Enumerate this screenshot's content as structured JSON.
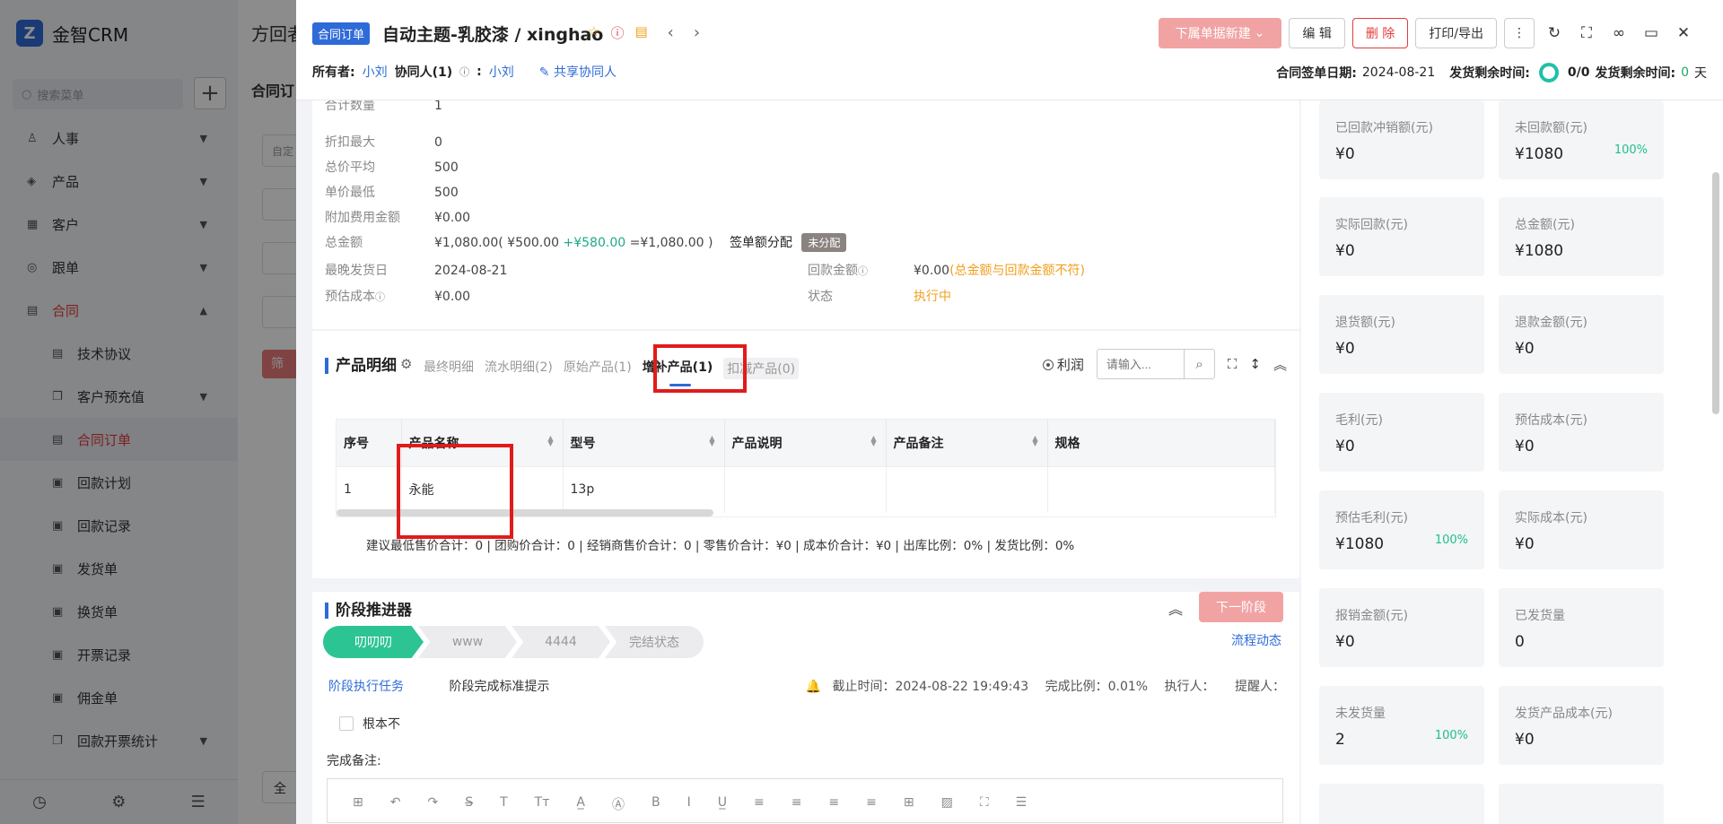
{
  "app": {
    "logo_text": "金智CRM",
    "logo_mark": "Z",
    "search_placeholder": "搜索菜单",
    "add_label": "+",
    "menu": [
      {
        "label": "人事",
        "icon": "person-icon"
      },
      {
        "label": "产品",
        "icon": "box-icon"
      },
      {
        "label": "客户",
        "icon": "building-icon"
      },
      {
        "label": "跟单",
        "icon": "target-icon"
      },
      {
        "label": "合同",
        "icon": "doc-icon"
      }
    ],
    "submenu": [
      "技术协议",
      "客户预充值",
      "合同订单",
      "回款计划",
      "回款记录",
      "发货单",
      "换货单",
      "开票记录",
      "佣金单",
      "回款开票统计"
    ]
  },
  "background": {
    "title": "方回者",
    "subtitle": "合同订",
    "box_text": "自定",
    "filter_label": "筛",
    "bottom_label": "全"
  },
  "header": {
    "tag": "合同订单",
    "title": "自动主题-乳胶漆 / xinghao",
    "new_doc_button": "下属单据新建",
    "edit_button": "编 辑",
    "delete_button": "删 除",
    "print_button": "打印/导出",
    "owner_label": "所有者:",
    "owner_value": "小刘",
    "collab_label": "协同人(1)",
    "collab_colon": ":",
    "collab_value": "小刘",
    "share_label": "共享协同人",
    "sign_date_label": "合同签单日期:",
    "sign_date_value": "2024-08-21",
    "ship_remain_label": "发货剩余时间:",
    "ship_ratio": "0/0",
    "ship_remain_label2": "发货剩余时间:",
    "ship_days": "0",
    "ship_days_unit": "天"
  },
  "info": {
    "rows": [
      {
        "k": "合计数量",
        "v": "1"
      },
      {
        "k": "折扣最大",
        "v": "0"
      },
      {
        "k": "总价平均",
        "v": "500"
      },
      {
        "k": "单价最低",
        "v": "500"
      },
      {
        "k": "附加费用金额",
        "v": "¥0.00"
      }
    ],
    "total_label": "总金额",
    "total_a": "¥1,080.00( ¥500.00 ",
    "total_b": "+¥580.00",
    "total_c": " =¥1,080.00 )",
    "sign_alloc": "签单额分配",
    "unallocated": "未分配",
    "latest_ship_label": "最晚发货日",
    "latest_ship_value": "2024-08-21",
    "payback_label": "回款金额",
    "payback_value": "¥0.00",
    "payback_warn": "(总金额与回款金额不符)",
    "est_cost_label": "预估成本",
    "est_cost_value": "¥0.00",
    "status_label": "状态",
    "status_value": "执行中"
  },
  "products": {
    "title": "产品明细",
    "tabs": [
      "最终明细",
      "流水明细(2)",
      "原始产品(1)",
      "增补产品(1)",
      "扣减产品(0)"
    ],
    "profit_label": "利润",
    "search_placeholder": "请输入...",
    "columns": [
      "序号",
      "产品名称",
      "型号",
      "产品说明",
      "产品备注",
      "规格"
    ],
    "rows": [
      {
        "no": "1",
        "name": "永能",
        "model": "13p",
        "desc": "",
        "remark": "",
        "spec": ""
      }
    ],
    "summary": "建议最低售价合计：0 |   团购价合计：0 |   经销商售价合计：0 |   零售价合计：¥0 |   成本价合计：¥0 |   出库比例：0% |   发货比例：0%"
  },
  "stage": {
    "title": "阶段推进器",
    "next_button": "下一阶段",
    "steps": [
      "叨叨叨",
      "www",
      "4444",
      "完结状态"
    ],
    "flow_link": "流程动态",
    "task_label": "阶段执行任务",
    "standard_label": "阶段完成标准提示",
    "deadline": "截止时间：2024-08-22 19:49:43",
    "ratio": "完成比例：0.01%",
    "executor": "执行人：",
    "reminder": "提醒人：",
    "checkbox_label": "根本不",
    "remark_label": "完成备注:"
  },
  "stats": [
    {
      "label": "已回款冲销额(元)",
      "value": "¥0",
      "pct": ""
    },
    {
      "label": "未回款额(元)",
      "value": "¥1080",
      "pct": "100%"
    },
    {
      "label": "实际回款(元)",
      "value": "¥0",
      "pct": ""
    },
    {
      "label": "总金额(元)",
      "value": "¥1080",
      "pct": ""
    },
    {
      "label": "退货额(元)",
      "value": "¥0",
      "pct": ""
    },
    {
      "label": "退款金额(元)",
      "value": "¥0",
      "pct": ""
    },
    {
      "label": "毛利(元)",
      "value": "¥0",
      "pct": ""
    },
    {
      "label": "预估成本(元)",
      "value": "¥0",
      "pct": ""
    },
    {
      "label": "预估毛利(元)",
      "value": "¥1080",
      "pct": "100%"
    },
    {
      "label": "实际成本(元)",
      "value": "¥0",
      "pct": ""
    },
    {
      "label": "报销金额(元)",
      "value": "¥0",
      "pct": ""
    },
    {
      "label": "已发货量",
      "value": "0",
      "pct": ""
    },
    {
      "label": "未发货量",
      "value": "2",
      "pct": "100%"
    },
    {
      "label": "发货产品成本(元)",
      "value": "¥0",
      "pct": ""
    }
  ]
}
